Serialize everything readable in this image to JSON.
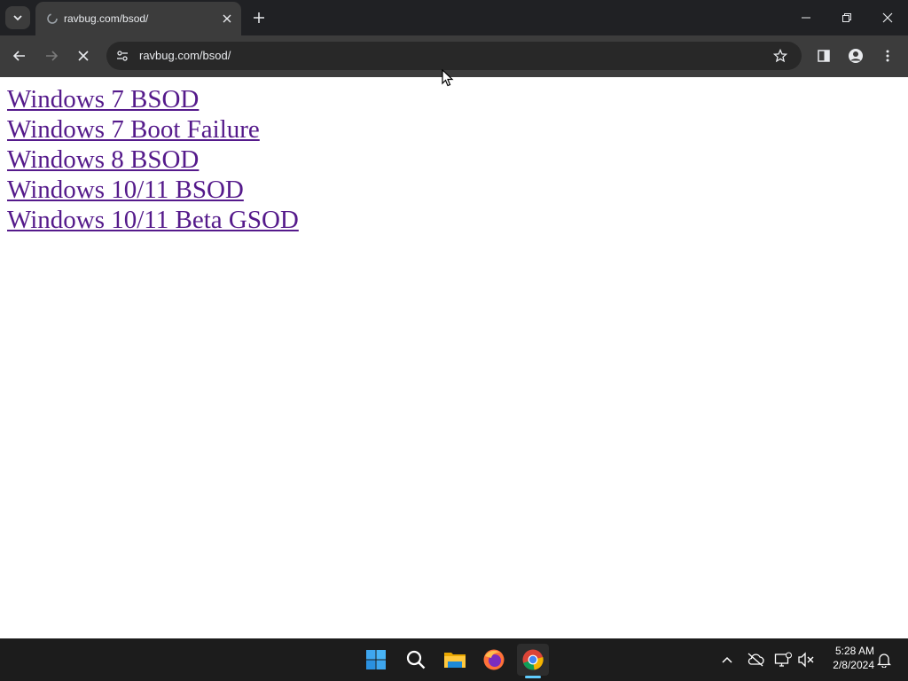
{
  "browser": {
    "tab": {
      "title": "ravbug.com/bsod/"
    },
    "omnibox": {
      "url": "ravbug.com/bsod/"
    }
  },
  "page": {
    "links": [
      "Windows 7 BSOD",
      "Windows 7 Boot Failure",
      "Windows 8 BSOD",
      "Windows 10/11 BSOD",
      "Windows 10/11 Beta GSOD"
    ]
  },
  "taskbar": {
    "apps": [
      "start-icon",
      "search-icon",
      "file-explorer-icon",
      "firefox-icon",
      "chrome-icon"
    ],
    "clock": {
      "time": "5:28 AM",
      "date": "2/8/2024"
    }
  },
  "colors": {
    "link": "#551a8b",
    "accent": "#60cdff"
  }
}
